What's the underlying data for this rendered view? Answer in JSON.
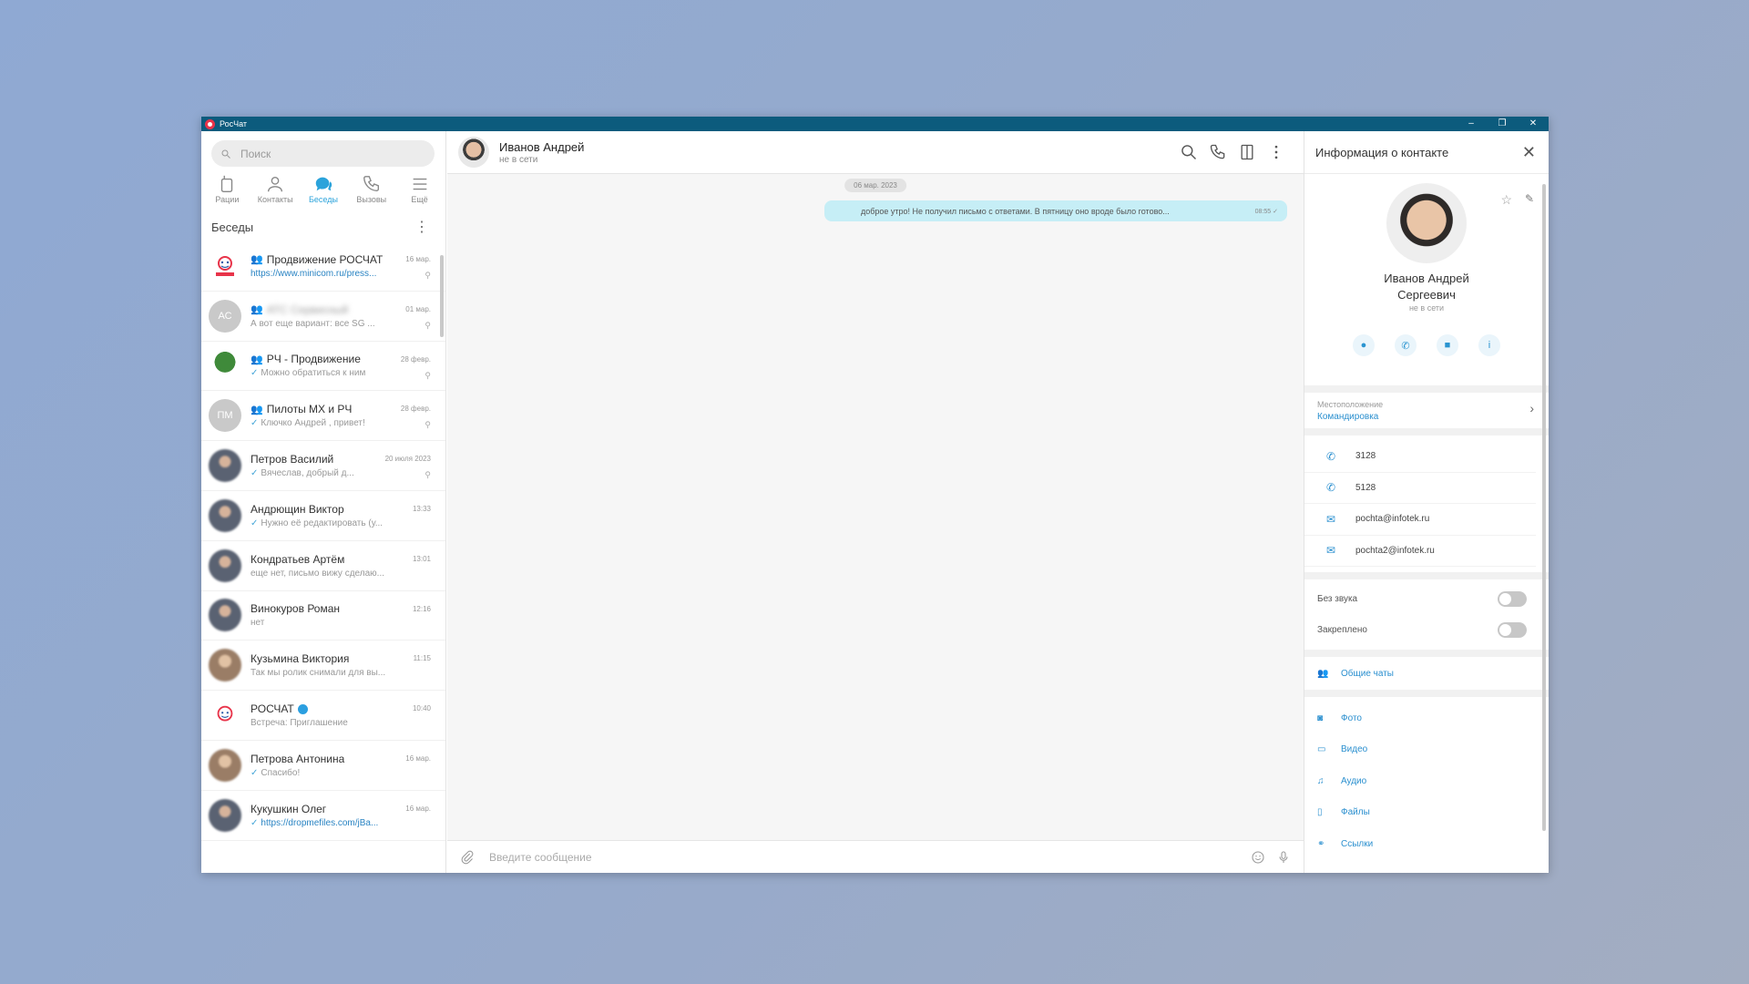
{
  "window": {
    "title": "РосЧат",
    "controls": [
      "–",
      "❐",
      "✕"
    ]
  },
  "sidebar": {
    "search_placeholder": "Поиск",
    "tabs": [
      {
        "label": "Рации",
        "icon": "radio-icon",
        "active": false
      },
      {
        "label": "Контакты",
        "icon": "contacts-icon",
        "active": false
      },
      {
        "label": "Беседы",
        "icon": "chats-icon",
        "active": true
      },
      {
        "label": "Вызовы",
        "icon": "phone-icon",
        "active": false
      },
      {
        "label": "Ещё",
        "icon": "menu-icon",
        "active": false
      }
    ],
    "section_title": "Беседы",
    "conversations": [
      {
        "name": "Продвижение РОСЧАТ",
        "group": true,
        "preview": "https://www.minicom.ru/press...",
        "preview_link": true,
        "time": "16 мар.",
        "pinned": true,
        "avatar": "logo"
      },
      {
        "name": "АТС Сервисный",
        "group": true,
        "blurred": true,
        "preview": "А вот еще вариант: все SG ...",
        "time": "01 мар.",
        "pinned": true,
        "avatar": "initials",
        "initials": "АС"
      },
      {
        "name": "РЧ - Продвижение",
        "group": true,
        "preview": "Можно обратиться к ним",
        "read": true,
        "time": "28 февр.",
        "pinned": true,
        "avatar": "tree"
      },
      {
        "name": "Пилоты МХ и РЧ",
        "group": true,
        "preview": "Ключко Андрей , привет!",
        "read": true,
        "time": "28 февр.",
        "pinned": true,
        "avatar": "initials",
        "initials": "ПМ"
      },
      {
        "name": "Петров Василий",
        "preview": "Вячеслав, добрый д...",
        "read": true,
        "time": "20 июля 2023",
        "pinned": true,
        "avatar": "photo"
      },
      {
        "name": "Андрющин Виктор",
        "preview": "Нужно её редактировать (у...",
        "read": true,
        "time": "13:33",
        "avatar": "photo"
      },
      {
        "name": "Кондратьев Артём",
        "preview": "еще нет, письмо вижу сделаю...",
        "time": "13:01",
        "avatar": "photo"
      },
      {
        "name": "Винокуров Роман",
        "preview": "нет",
        "time": "12:16",
        "avatar": "photo"
      },
      {
        "name": "Кузьмина Виктория",
        "preview": "Так мы ролик снимали для вы...",
        "time": "11:15",
        "avatar": "photo2"
      },
      {
        "name": "РОСЧАТ",
        "verified": true,
        "preview": "Встреча: Приглашение",
        "time": "10:40",
        "avatar": "logo"
      },
      {
        "name": "Петрова Антонина",
        "preview": "Спасибо!",
        "read": true,
        "time": "16 мар.",
        "avatar": "photo2"
      },
      {
        "name": "Кукушкин Олег",
        "preview": "https://dropmefiles.com/jBa...",
        "preview_link": true,
        "read": true,
        "time": "16 мар.",
        "avatar": "photo"
      }
    ]
  },
  "chat": {
    "contact_name": "Иванов Андрей",
    "contact_status": "не в сети",
    "date_separator": "06 мар. 2023",
    "messages": [
      {
        "text": "доброе утро! Не получил письмо с ответами. В пятницу оно вроде было готово...",
        "time": "08:55",
        "outgoing": true
      }
    ],
    "composer_placeholder": "Введите сообщение"
  },
  "info_panel": {
    "title": "Информация о контакте",
    "full_name_line1": "Иванов Андрей",
    "full_name_line2": "Сергеевич",
    "status": "не в сети",
    "location_label": "Местоположение",
    "location_value": "Командировка",
    "contacts": [
      {
        "type": "phone",
        "value": "3128"
      },
      {
        "type": "phone",
        "value": "5128"
      },
      {
        "type": "email",
        "value": "pochta@infotek.ru"
      },
      {
        "type": "email",
        "value": "pochta2@infotek.ru"
      }
    ],
    "mute_label": "Без звука",
    "pinned_label": "Закреплено",
    "common_chats_label": "Общие чаты",
    "media": [
      {
        "label": "Фото",
        "icon": "camera-icon"
      },
      {
        "label": "Видео",
        "icon": "video-icon"
      },
      {
        "label": "Аудио",
        "icon": "music-icon"
      },
      {
        "label": "Файлы",
        "icon": "file-icon"
      },
      {
        "label": "Ссылки",
        "icon": "link-icon"
      }
    ]
  },
  "colors": {
    "titlebar": "#0c5b7d",
    "accent": "#2ba3db",
    "bubble_out": "#c6eef6"
  }
}
